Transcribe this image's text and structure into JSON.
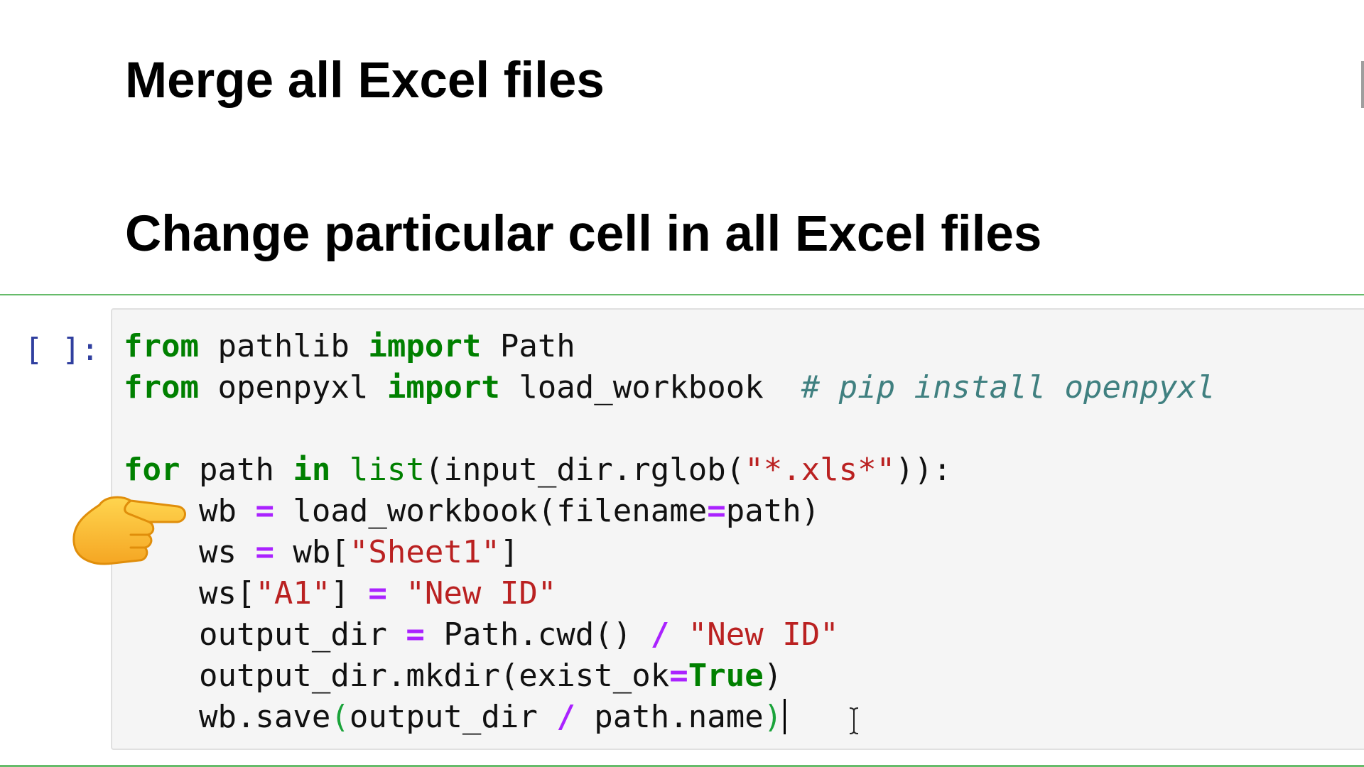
{
  "notebook": {
    "headings": [
      "Merge all Excel files",
      "Change particular cell in all Excel files"
    ],
    "cell": {
      "prompt": "[ ]:",
      "code": {
        "line1": {
          "kw1": "from",
          "mod": " pathlib ",
          "kw2": "import",
          "name": " Path"
        },
        "line2": {
          "kw1": "from",
          "mod": " openpyxl ",
          "kw2": "import",
          "name": " load_workbook  ",
          "comment": "# pip install openpyxl"
        },
        "line4": {
          "kw1": "for",
          "t1": " path ",
          "kw2": "in",
          "t2": " ",
          "builtin": "list",
          "t3": "(input_dir.rglob(",
          "str": "\"*.xls*\"",
          "t4": ")):"
        },
        "line5": {
          "t1": "    wb ",
          "op": "=",
          "t2": " load_workbook(filename",
          "op2": "=",
          "t3": "path)"
        },
        "line6": {
          "t1": "    ws ",
          "op": "=",
          "t2": " wb[",
          "str": "\"Sheet1\"",
          "t3": "]"
        },
        "line7": {
          "t1": "    ws[",
          "str1": "\"A1\"",
          "t2": "] ",
          "op": "=",
          "t3": " ",
          "str2": "\"New ID\""
        },
        "line8": {
          "t1": "    output_dir ",
          "op": "=",
          "t2": " Path.cwd() ",
          "op2": "/",
          "t3": " ",
          "str": "\"New ID\""
        },
        "line9": {
          "t1": "    output_dir.mkdir(exist_ok",
          "op": "=",
          "kw": "True",
          "t2": ")"
        },
        "line10": {
          "t1": "    wb.save",
          "p1": "(",
          "t2": "output_dir ",
          "op": "/",
          "t3": " path.name",
          "p2": ")"
        }
      }
    }
  },
  "colors": {
    "keyword": "#008000",
    "string": "#ba2121",
    "operator": "#aa22ff",
    "comment": "#408080",
    "prompt": "#303f9f",
    "cell_border": "#66bb6a"
  },
  "icons": {
    "pointer": "pointing-hand-icon",
    "cursor": "text-cursor-icon"
  }
}
